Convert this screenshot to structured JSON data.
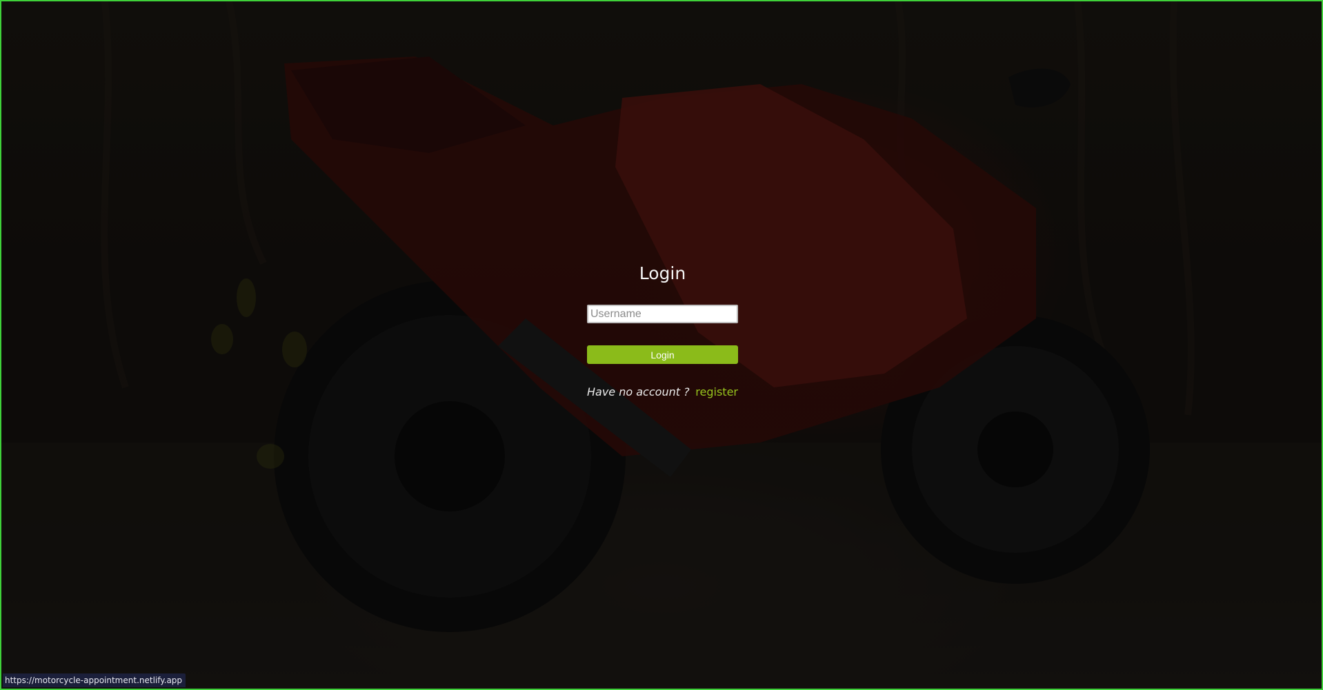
{
  "login": {
    "title": "Login",
    "username_placeholder": "Username",
    "username_value": "",
    "button_label": "Login",
    "no_account_text": "Have no account ?",
    "register_label": "register"
  },
  "status_bar": {
    "url": "https://motorcycle-appointment.netlify.app"
  },
  "colors": {
    "accent": "#8bbb1a",
    "link": "#98c61d",
    "frame_border": "#3fd13a"
  },
  "background": {
    "description_icon": "motorcycle-photo"
  }
}
